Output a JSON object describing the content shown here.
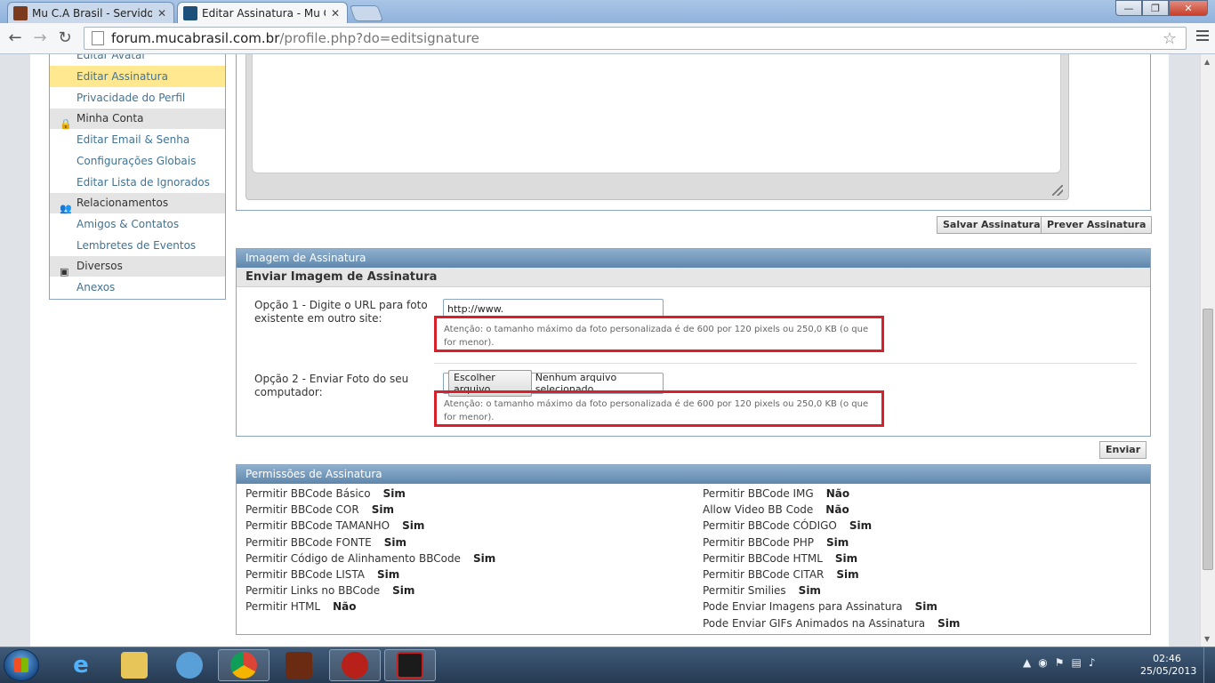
{
  "browser": {
    "tabs": [
      {
        "title": "Mu C.A Brasil - Servidor B"
      },
      {
        "title": "Editar Assinatura - Mu C.A"
      }
    ],
    "url_host": "forum.mucabrasil.com.br",
    "url_path": "/profile.php?do=editsignature",
    "nav": {
      "back": "←",
      "forward": "→",
      "reload": "↻"
    }
  },
  "sidebar": {
    "items": [
      {
        "label": "Editar Avatar"
      },
      {
        "label": "Editar Assinatura"
      },
      {
        "label": "Privacidade do Perfil"
      }
    ],
    "section_minha_conta": "Minha Conta",
    "minha_conta_items": [
      {
        "label": "Editar Email & Senha"
      },
      {
        "label": "Configurações Globais"
      },
      {
        "label": "Editar Lista de Ignorados"
      }
    ],
    "section_relacionamentos": "Relacionamentos",
    "relacionamentos_items": [
      {
        "label": "Amigos & Contatos"
      },
      {
        "label": "Lembretes de Eventos"
      }
    ],
    "section_diversos": "Diversos",
    "diversos_items": [
      {
        "label": "Anexos"
      }
    ]
  },
  "buttons": {
    "save": "Salvar Assinatura",
    "preview": "Prever Assinatura",
    "send": "Enviar"
  },
  "image_panel": {
    "header": "Imagem de Assinatura",
    "subheader": "Enviar Imagem de Assinatura",
    "option1_label": "Opção 1 - Digite o URL para foto existente em outro site:",
    "option1_value": "http://www.",
    "hint": "Atenção: o tamanho máximo da foto personalizada é de 600 por 120 pixels ou 250,0 KB (o que for menor).",
    "option2_label": "Opção 2 - Enviar Foto do seu computador:",
    "file_button": "Escolher arquivo",
    "file_status": "Nenhum arquivo selecionado"
  },
  "permissions": {
    "header": "Permissões de Assinatura",
    "left": [
      {
        "label": "Permitir BBCode Básico",
        "value": "Sim"
      },
      {
        "label": "Permitir BBCode COR",
        "value": "Sim"
      },
      {
        "label": "Permitir BBCode TAMANHO",
        "value": "Sim"
      },
      {
        "label": "Permitir BBCode FONTE",
        "value": "Sim"
      },
      {
        "label": "Permitir Código de Alinhamento BBCode",
        "value": "Sim"
      },
      {
        "label": "Permitir BBCode LISTA",
        "value": "Sim"
      },
      {
        "label": "Permitir Links no BBCode",
        "value": "Sim"
      },
      {
        "label": "Permitir HTML",
        "value": "Não"
      }
    ],
    "right": [
      {
        "label": "Permitir BBCode IMG",
        "value": "Não"
      },
      {
        "label": "Allow Video BB Code",
        "value": "Não"
      },
      {
        "label": "Permitir BBCode CÓDIGO",
        "value": "Sim"
      },
      {
        "label": "Permitir BBCode PHP",
        "value": "Sim"
      },
      {
        "label": "Permitir BBCode HTML",
        "value": "Sim"
      },
      {
        "label": "Permitir BBCode CITAR",
        "value": "Sim"
      },
      {
        "label": "Permitir Smilies",
        "value": "Sim"
      },
      {
        "label": "Pode Enviar Imagens para Assinatura",
        "value": "Sim"
      },
      {
        "label": "Pode Enviar GIFs Animados na Assinatura",
        "value": "Sim"
      }
    ]
  },
  "taskbar": {
    "clock_time": "02:46",
    "clock_date": "25/05/2013",
    "tray_arrow": "▲"
  },
  "colors": {
    "accent_link": "#417394",
    "highlight": "#ffe890",
    "warning_border": "#d8202a"
  }
}
